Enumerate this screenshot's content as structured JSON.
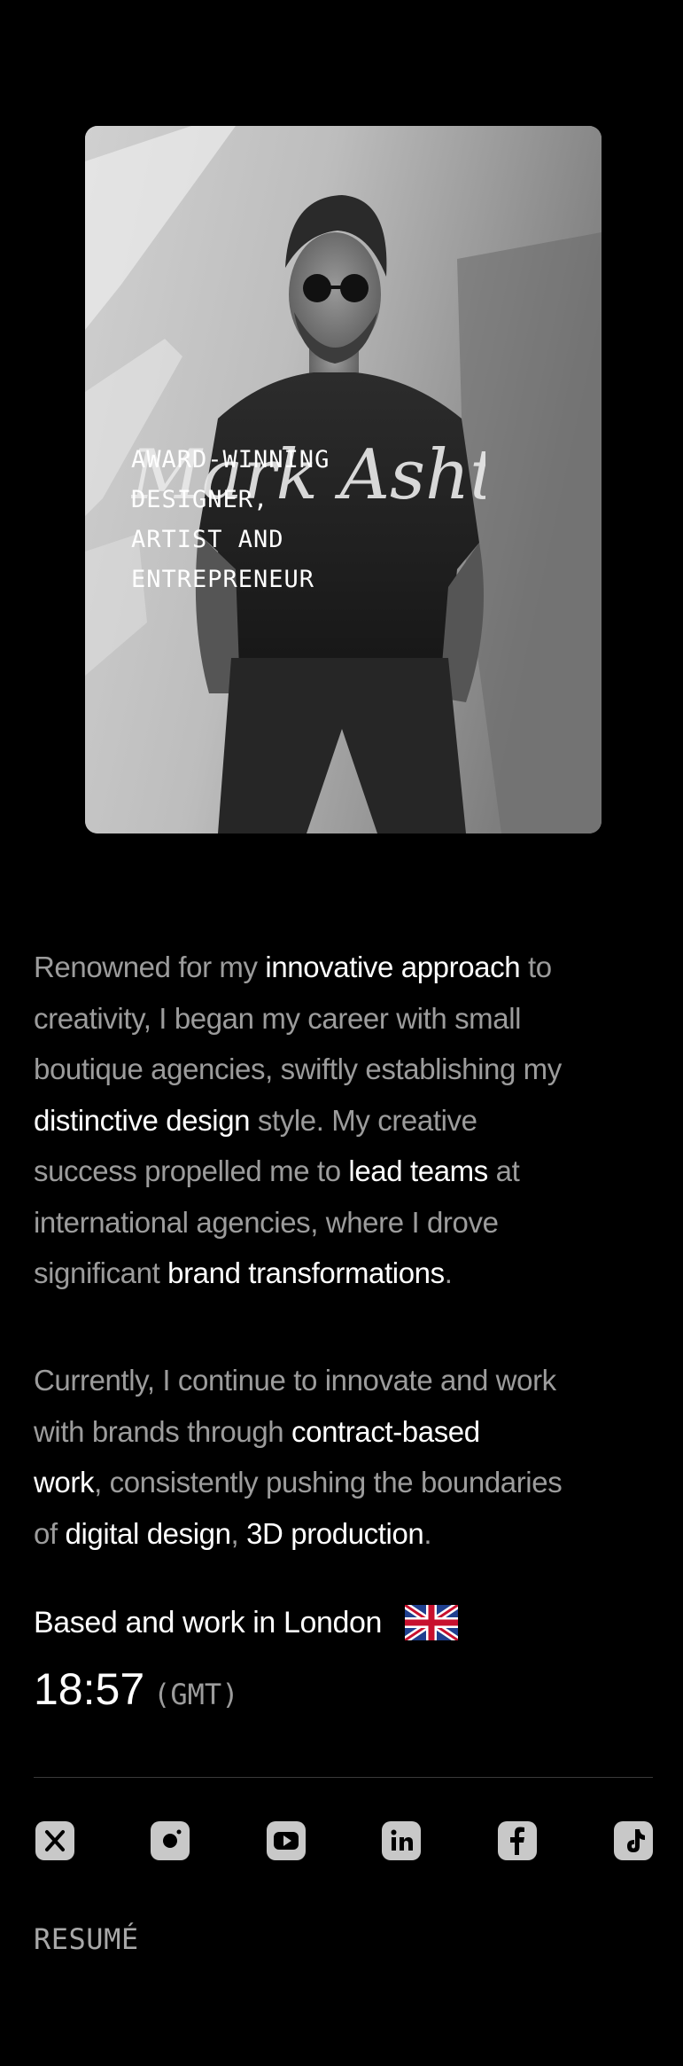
{
  "hero": {
    "signature": "Mark Ashton",
    "tagline_lines": [
      "AWARD-WINNING",
      "DESIGNER,",
      "ARTIST AND",
      "ENTREPRENEUR"
    ]
  },
  "bio": {
    "paragraph_1": [
      [
        {
          "t": "Renowned for my ",
          "h": false
        },
        {
          "t": "innovative approach",
          "h": true
        },
        {
          "t": " to",
          "h": false
        }
      ],
      [
        {
          "t": "creativity, I began my career with small",
          "h": false
        }
      ],
      [
        {
          "t": "boutique agencies, swiftly establishing my",
          "h": false
        }
      ],
      [
        {
          "t": "distinctive design",
          "h": true
        },
        {
          "t": " style. My creative",
          "h": false
        }
      ],
      [
        {
          "t": "success propelled me to ",
          "h": false
        },
        {
          "t": "lead teams",
          "h": true
        },
        {
          "t": " at",
          "h": false
        }
      ],
      [
        {
          "t": "international agencies, where I drove",
          "h": false
        }
      ],
      [
        {
          "t": "significant ",
          "h": false
        },
        {
          "t": "brand transformations",
          "h": true
        },
        {
          "t": ".",
          "h": false
        }
      ]
    ],
    "paragraph_2": [
      [
        {
          "t": "Currently, I continue to innovate and work",
          "h": false
        }
      ],
      [
        {
          "t": "with brands through ",
          "h": false
        },
        {
          "t": "contract-based",
          "h": true
        }
      ],
      [
        {
          "t": "work",
          "h": true
        },
        {
          "t": ", consistently pushing the boundaries",
          "h": false
        }
      ],
      [
        {
          "t": "of ",
          "h": false
        },
        {
          "t": "digital design",
          "h": true
        },
        {
          "t": ", ",
          "h": false
        },
        {
          "t": "3D production",
          "h": true
        },
        {
          "t": ".",
          "h": false
        }
      ]
    ]
  },
  "location": {
    "text": "Based and work in London",
    "flag_icon": "uk-flag-icon"
  },
  "clock": {
    "time": "18:57",
    "timezone": "(GMT)"
  },
  "socials": [
    {
      "icon": "x-icon",
      "name": "social-x"
    },
    {
      "icon": "instagram-icon",
      "name": "social-instagram"
    },
    {
      "icon": "youtube-icon",
      "name": "social-youtube"
    },
    {
      "icon": "linkedin-icon",
      "name": "social-linkedin"
    },
    {
      "icon": "facebook-icon",
      "name": "social-facebook"
    },
    {
      "icon": "tiktok-icon",
      "name": "social-tiktok"
    }
  ],
  "resume": {
    "label": "RESUMÉ"
  },
  "colors": {
    "background": "#000000",
    "text_highlight": "#ffffff",
    "text_muted": "#9c9c9c",
    "icon_fill": "#c8c8c8"
  }
}
